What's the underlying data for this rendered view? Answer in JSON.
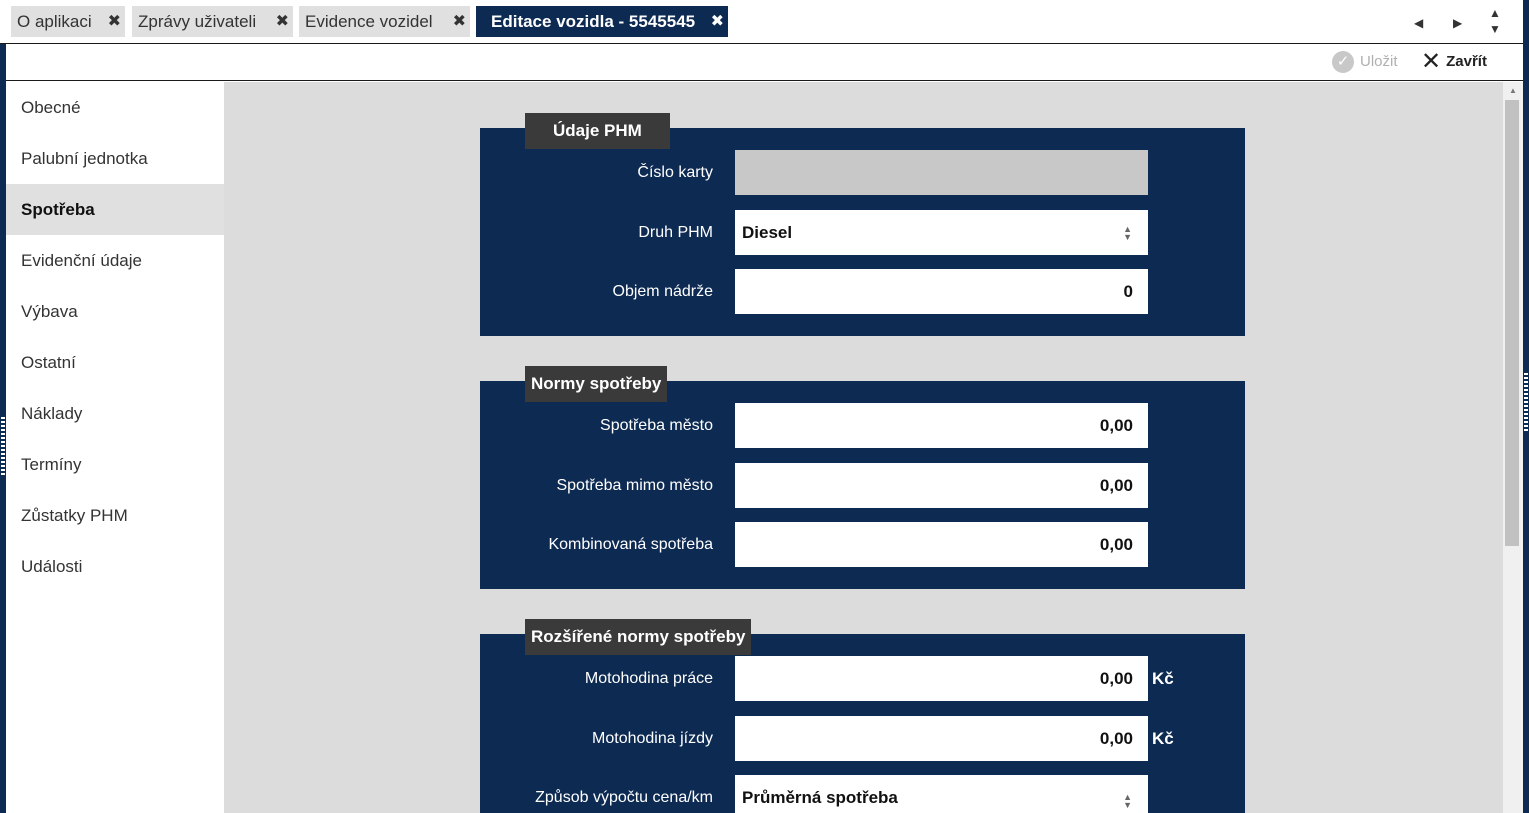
{
  "tabs": [
    {
      "label": "O aplikaci",
      "close": "✖"
    },
    {
      "label": "Zprávy uživateli",
      "close": "✖"
    },
    {
      "label": "Evidence vozidel",
      "close": "✖"
    },
    {
      "label": "Editace vozidla - 5545545",
      "close": "✖",
      "active": true
    }
  ],
  "tab_nav": {
    "prev": "◀",
    "next": "▶",
    "up": "▲",
    "down": "▼"
  },
  "toolbar": {
    "save_label": "Uložit",
    "close_label": "Zavřít"
  },
  "sidebar": {
    "items": [
      {
        "label": "Obecné"
      },
      {
        "label": "Palubní jednotka"
      },
      {
        "label": "Spotřeba",
        "active": true
      },
      {
        "label": "Evidenční údaje"
      },
      {
        "label": "Výbava"
      },
      {
        "label": "Ostatní"
      },
      {
        "label": "Náklady"
      },
      {
        "label": "Termíny"
      },
      {
        "label": "Zůstatky PHM"
      },
      {
        "label": "Události"
      }
    ]
  },
  "sections": {
    "phm": {
      "title": "Údaje PHM",
      "card_number": {
        "label": "Číslo karty",
        "value": ""
      },
      "fuel_type": {
        "label": "Druh PHM",
        "value": "Diesel"
      },
      "tank_volume": {
        "label": "Objem nádrže",
        "value": "0"
      }
    },
    "norms": {
      "title": "Normy spotřeby",
      "city": {
        "label": "Spotřeba město",
        "value": "0,00"
      },
      "outside_city": {
        "label": "Spotřeba mimo město",
        "value": "0,00"
      },
      "combined": {
        "label": "Kombinovaná spotřeba",
        "value": "0,00"
      }
    },
    "extended": {
      "title": "Rozšířené normy spotřeby",
      "engine_hour_work": {
        "label": "Motohodina práce",
        "value": "0,00",
        "unit": "Kč"
      },
      "engine_hour_drive": {
        "label": "Motohodina jízdy",
        "value": "0,00",
        "unit": "Kč"
      },
      "calc_method": {
        "label": "Způsob výpočtu cena/km",
        "value": "Průměrná spotřeba"
      }
    }
  },
  "colors": {
    "primary": "#0d2a52",
    "section_title": "#3a3a3a",
    "content_bg": "#dcdcdc",
    "tab_bg": "#e0e0e0"
  }
}
